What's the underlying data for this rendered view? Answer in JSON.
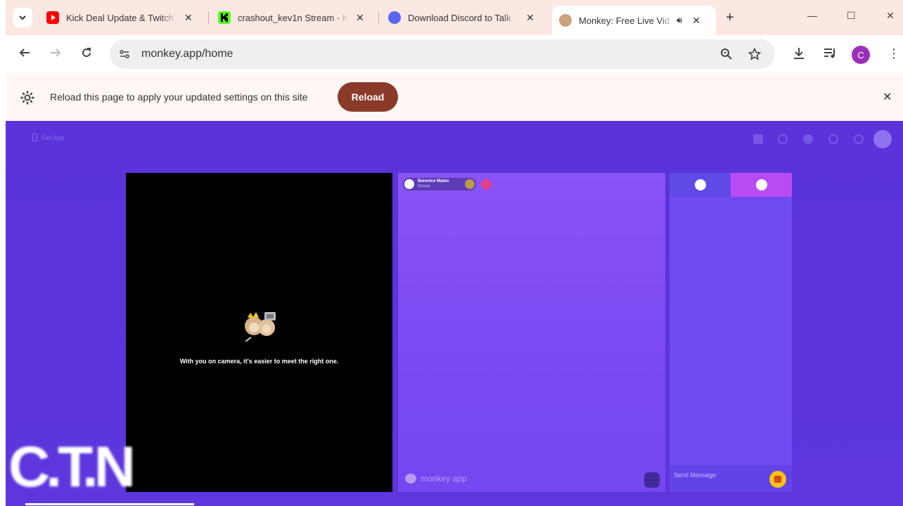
{
  "browser": {
    "tabs": [
      {
        "title": "Kick Deal Update & Twitch",
        "favicon": "youtube-icon",
        "color": "#ff0000",
        "active": false
      },
      {
        "title": "crashout_kev1n Stream - K",
        "favicon": "kick-icon",
        "color": "#53fc18",
        "active": false
      },
      {
        "title": "Download Discord to Talk",
        "favicon": "discord-icon",
        "color": "#5865f2",
        "active": false
      },
      {
        "title": "Monkey: Free Live Vid",
        "favicon": "monkey-icon",
        "color": "#c9a27c",
        "active": true
      }
    ],
    "url": "monkey.app/home",
    "profile_initial": "C",
    "profile_color": "#9b30b8"
  },
  "infobar": {
    "message": "Reload this page to apply your updated settings on this site",
    "button_label": "Reload",
    "button_color": "#8a3a28"
  },
  "page": {
    "get_app_label": "Get App",
    "camera_message": "With you on camera, it's easier to meet the right one.",
    "stranger": {
      "name": "Berenice Mateo",
      "status": "Ga.laxg"
    },
    "brand_label": "monkey app",
    "chat_placeholder": "Send Message",
    "accent_color": "#5b34d9"
  },
  "overlay": {
    "watermark": "C.T.N"
  }
}
